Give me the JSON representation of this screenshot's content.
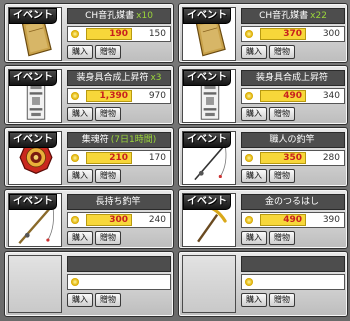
{
  "event_label": "イベント",
  "buy_label": "購入",
  "gift_label": "贈物",
  "items": [
    {
      "name": "CH音孔媒書",
      "qty": "x10",
      "sale": "190",
      "orig": "150",
      "icon": "book-icon"
    },
    {
      "name": "CH音孔媒書",
      "qty": "x22",
      "sale": "370",
      "orig": "300",
      "icon": "book-icon"
    },
    {
      "name": "装身具合成上昇符",
      "qty": "x3",
      "sale": "1,390",
      "orig": "970",
      "icon": "talisman-icon"
    },
    {
      "name": "装身具合成上昇符",
      "qty": "",
      "sale": "490",
      "orig": "340",
      "icon": "talisman-icon"
    },
    {
      "name": "集魂符",
      "qty": "(7日1時間)",
      "sale": "210",
      "orig": "170",
      "icon": "bagua-icon"
    },
    {
      "name": "職人の釣竿",
      "qty": "",
      "sale": "350",
      "orig": "280",
      "icon": "fishing-rod-icon"
    },
    {
      "name": "長持ち釣竿",
      "qty": "",
      "sale": "300",
      "orig": "240",
      "icon": "fishing-rod-icon"
    },
    {
      "name": "金のつるはし",
      "qty": "",
      "sale": "490",
      "orig": "390",
      "icon": "pickaxe-icon"
    }
  ],
  "colors": {
    "accent_title_qty": "#9bd63a",
    "sale_price": "#c8201e",
    "sale_bg": "#f7d73a"
  }
}
